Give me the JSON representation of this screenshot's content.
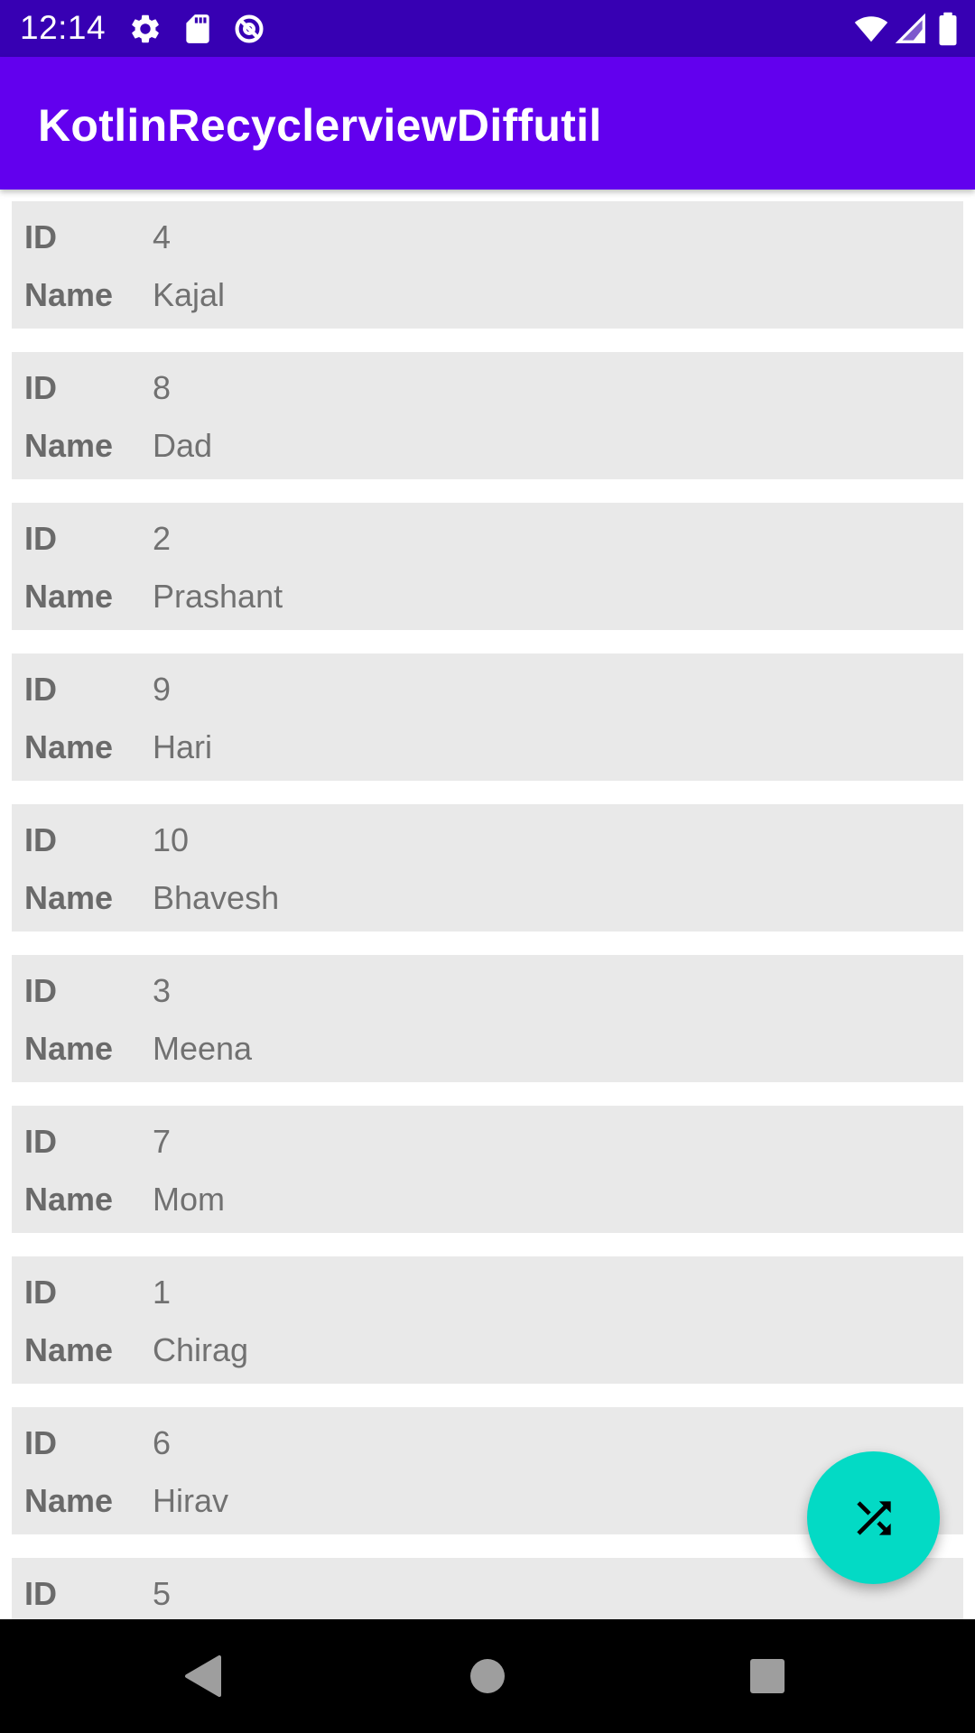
{
  "status_bar": {
    "time": "12:14",
    "icons": [
      "settings-icon",
      "sd-card-icon",
      "data-saver-icon",
      "wifi-icon",
      "signal-icon",
      "battery-icon"
    ]
  },
  "app_bar": {
    "title": "KotlinRecyclerviewDiffutil",
    "color": "#6200ee"
  },
  "list": {
    "id_label": "ID",
    "name_label": "Name",
    "items": [
      {
        "id": "4",
        "name": "Kajal"
      },
      {
        "id": "8",
        "name": "Dad"
      },
      {
        "id": "2",
        "name": "Prashant"
      },
      {
        "id": "9",
        "name": "Hari"
      },
      {
        "id": "10",
        "name": "Bhavesh"
      },
      {
        "id": "3",
        "name": "Meena"
      },
      {
        "id": "7",
        "name": "Mom"
      },
      {
        "id": "1",
        "name": "Chirag"
      },
      {
        "id": "6",
        "name": "Hirav"
      },
      {
        "id": "5",
        "name": ""
      }
    ]
  },
  "fab": {
    "icon": "shuffle-icon",
    "color": "#03dac5"
  },
  "nav_bar": {
    "icons": [
      "back-icon",
      "home-icon",
      "recents-icon"
    ]
  }
}
